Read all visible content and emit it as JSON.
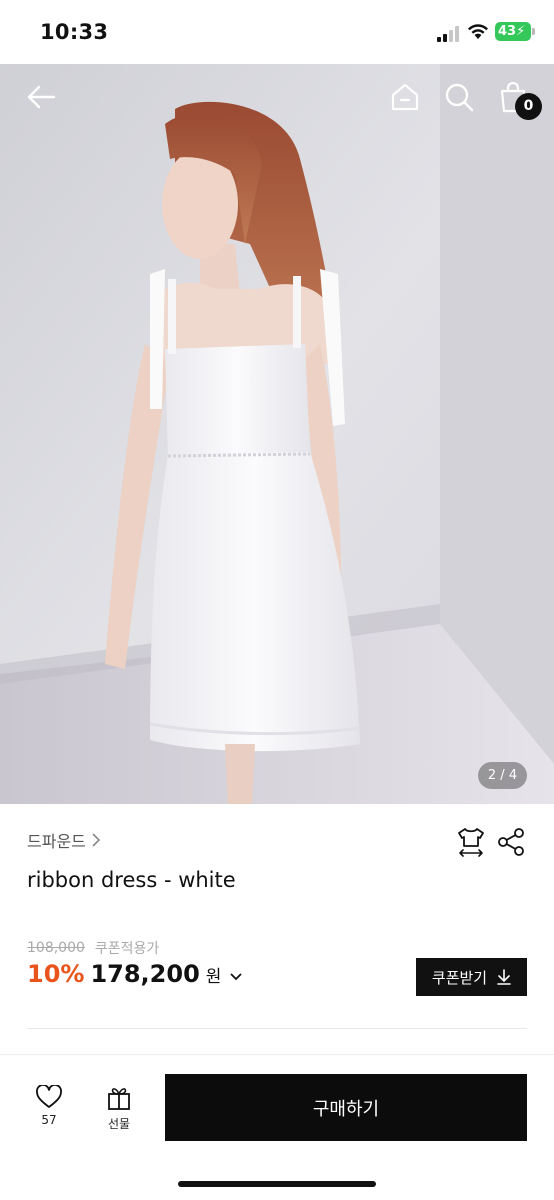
{
  "status_bar": {
    "time": "10:33",
    "battery": "43"
  },
  "header": {
    "cart_count": "0",
    "icons": [
      "back-arrow-icon",
      "home-icon",
      "search-icon",
      "shopping-bag-icon"
    ]
  },
  "gallery": {
    "page_indicator": "2 / 4"
  },
  "product": {
    "brand": "드파운드",
    "title": "ribbon dress - white",
    "original_price": "108,000",
    "coupon_label": "쿠폰적용가",
    "discount_rate": "10%",
    "sale_price": "178,200",
    "currency": "원",
    "coupon_button_label": "쿠폰받기",
    "accent_color": "#e8541c"
  },
  "bottom_bar": {
    "like_count": "57",
    "gift_label": "선물",
    "buy_label": "구매하기"
  }
}
